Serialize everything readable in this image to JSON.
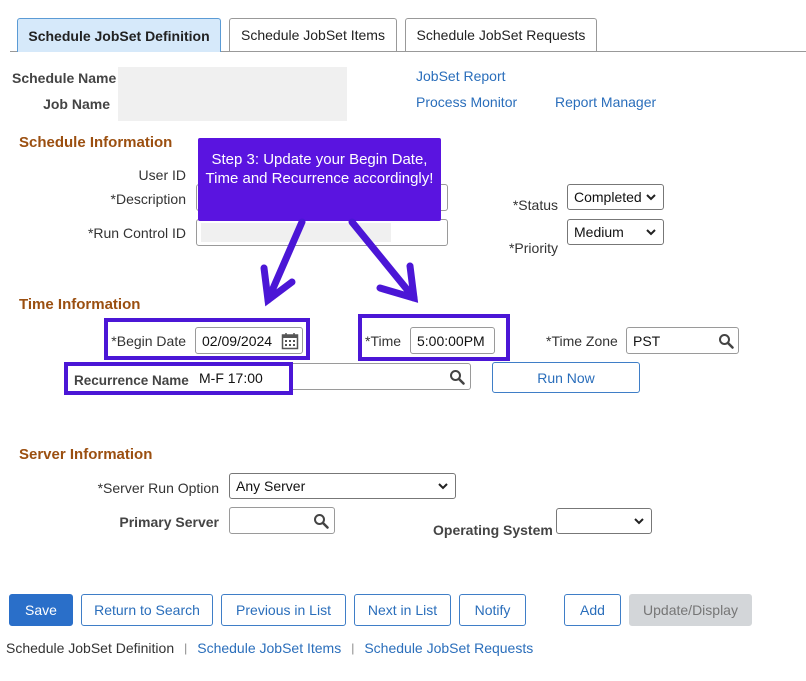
{
  "tabs": [
    {
      "label": "Schedule JobSet Definition",
      "active": true
    },
    {
      "label": "Schedule JobSet Items",
      "active": false
    },
    {
      "label": "Schedule JobSet Requests",
      "active": false
    }
  ],
  "header": {
    "schedule_name_label": "Schedule Name",
    "job_name_label": "Job Name",
    "jobset_report_link": "JobSet Report",
    "process_monitor_link": "Process Monitor",
    "report_manager_link": "Report Manager"
  },
  "schedule_info": {
    "title": "Schedule Information",
    "user_id_label": "User ID",
    "description_label": "*Description",
    "run_control_label": "*Run Control ID",
    "status_label": "*Status",
    "status_value": "Completed",
    "priority_label": "*Priority",
    "priority_value": "Medium"
  },
  "callout": {
    "text": "Step 3: Update your Begin Date, Time and Recurrence accordingly!"
  },
  "time_info": {
    "title": "Time Information",
    "begin_date_label": "*Begin Date",
    "begin_date_value": "02/09/2024",
    "time_label": "*Time",
    "time_value": "5:00:00PM",
    "time_zone_label": "*Time Zone",
    "time_zone_value": "PST",
    "recurrence_label": "Recurrence Name",
    "recurrence_value": "M-F 17:00",
    "run_now_label": "Run Now"
  },
  "server_info": {
    "title": "Server Information",
    "server_run_option_label": "*Server Run Option",
    "server_run_option_value": "Any Server",
    "primary_server_label": "Primary Server",
    "operating_system_label": "Operating System"
  },
  "buttons": {
    "save": "Save",
    "return_to_search": "Return to Search",
    "previous_in_list": "Previous in List",
    "next_in_list": "Next in List",
    "notify": "Notify",
    "add": "Add",
    "update_display": "Update/Display"
  },
  "footer": {
    "definition": "Schedule JobSet Definition",
    "items": "Schedule JobSet Items",
    "requests": "Schedule JobSet Requests",
    "separator": "|"
  },
  "colors": {
    "highlight": "#4b16d6",
    "callout": "#5a14e0",
    "section": "#9b4f10",
    "link": "#2a6ebb",
    "primary_button": "#2a6fc9"
  },
  "icons": [
    "calendar-icon",
    "search-icon",
    "chevron-down-icon"
  ]
}
